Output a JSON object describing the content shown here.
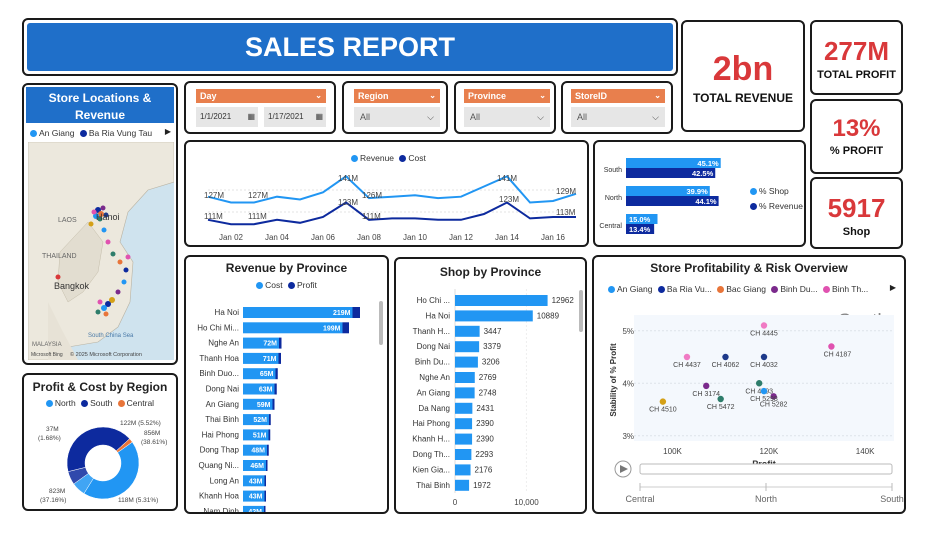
{
  "header": {
    "title": "SALES REPORT"
  },
  "kpis": {
    "revenue": {
      "value": "2bn",
      "label": "TOTAL REVENUE"
    },
    "profit": {
      "value": "277M",
      "label": "TOTAL PROFIT"
    },
    "profit_pct": {
      "value": "13%",
      "label": "% PROFIT"
    },
    "shop": {
      "value": "5917",
      "label": "Shop"
    }
  },
  "colors": {
    "revenue": "#2196f3",
    "cost": "#0d2a9e",
    "north": "#2196f3",
    "south": "#0d2a9e",
    "central": "#e8753a",
    "kpi_red": "#d9383a",
    "title_blue": "#1f6fc9"
  },
  "map": {
    "title": "Store Locations & Revenue",
    "legend": [
      {
        "label": "An Giang",
        "color": "#2196f3"
      },
      {
        "label": "Ba Ria Vung Tau",
        "color": "#0d2a9e"
      }
    ],
    "labels": {
      "hanoi": "Hanoi",
      "laos": "LAOS",
      "thailand": "THAILAND",
      "bangkok": "Bangkok",
      "scs": "South China Sea",
      "malaysia": "MALAYSIA",
      "credit": "© 2025 Microsoft Corporation",
      "bing": "Microsoft Bing"
    }
  },
  "filters": {
    "day": {
      "label": "Day",
      "start": "1/1/2021",
      "end": "1/17/2021"
    },
    "region": {
      "label": "Region",
      "value": "All"
    },
    "province": {
      "label": "Province",
      "value": "All"
    },
    "storeid": {
      "label": "StoreID",
      "value": "All"
    }
  },
  "line_chart": {
    "legend": {
      "revenue": "Revenue",
      "cost": "Cost"
    },
    "x_labels": [
      "Jan 02",
      "Jan 04",
      "Jan 06",
      "Jan 08",
      "Jan 10",
      "Jan 12",
      "Jan 14",
      "Jan 16"
    ],
    "revenue_labels": [
      "127M",
      "127M",
      "141M",
      "126M",
      "141M",
      "123M",
      "129M"
    ],
    "cost_labels": [
      "111M",
      "111M",
      "123M",
      "111M",
      "113M"
    ]
  },
  "region_bars": {
    "legend": {
      "shop": "% Shop",
      "revenue": "% Revenue"
    },
    "rows": [
      {
        "label": "South",
        "shop": "45.1%",
        "revenue": "42.5%"
      },
      {
        "label": "North",
        "shop": "39.9%",
        "revenue": "44.1%"
      },
      {
        "label": "Central",
        "shop": "15.0%",
        "revenue": "13.4%"
      }
    ]
  },
  "donut": {
    "title": "Profit & Cost by Region",
    "legend": [
      {
        "label": "North",
        "color": "#2196f3"
      },
      {
        "label": "South",
        "color": "#0d2a9e"
      },
      {
        "label": "Central",
        "color": "#e8753a"
      }
    ],
    "labels": {
      "tl1": "37M",
      "tl2": "(1.68%)",
      "tr1": "122M (5.52%)",
      "tr2": "856M",
      "tr3": "(38.61%)",
      "bl1": "823M",
      "bl2": "(37.16%)",
      "br1": "118M (5.31%)"
    }
  },
  "chart_data": [
    {
      "type": "line",
      "title": "",
      "x": [
        "Jan 01",
        "Jan 02",
        "Jan 03",
        "Jan 04",
        "Jan 05",
        "Jan 06",
        "Jan 07",
        "Jan 08",
        "Jan 09",
        "Jan 10",
        "Jan 11",
        "Jan 12",
        "Jan 13",
        "Jan 14",
        "Jan 15",
        "Jan 16",
        "Jan 17"
      ],
      "series": [
        {
          "name": "Revenue",
          "values": [
            127,
            123,
            123,
            127,
            125,
            130,
            141,
            126,
            127,
            128,
            126,
            127,
            134,
            141,
            123,
            124,
            129
          ]
        },
        {
          "name": "Cost",
          "values": [
            111,
            108,
            108,
            111,
            109,
            113,
            123,
            111,
            112,
            112,
            111,
            111,
            115,
            123,
            112,
            113,
            113
          ]
        }
      ]
    },
    {
      "type": "bar",
      "title": "Revenue by Province",
      "categories": [
        "Ha Noi",
        "Ho Chi Mi...",
        "Nghe An",
        "Thanh Hoa",
        "Binh Duo...",
        "Dong Nai",
        "An Giang",
        "Thai Binh",
        "Hai Phong",
        "Dong Thap",
        "Quang Ni...",
        "Long An",
        "Khanh Hoa",
        "Nam Dinh"
      ],
      "series": [
        {
          "name": "Cost",
          "values": [
            219,
            199,
            72,
            71,
            65,
            63,
            59,
            52,
            51,
            48,
            46,
            43,
            43,
            42
          ]
        },
        {
          "name": "Profit",
          "values": [
            30,
            26,
            10,
            10,
            9,
            9,
            8,
            7,
            7,
            7,
            6,
            6,
            6,
            6
          ]
        }
      ]
    },
    {
      "type": "bar",
      "title": "Shop by Province",
      "categories": [
        "Ho Chi ...",
        "Ha Noi",
        "Thanh H...",
        "Dong Nai",
        "Binh Du...",
        "Nghe An",
        "An Giang",
        "Da Nang",
        "Hai Phong",
        "Khanh H...",
        "Dong Th...",
        "Kien Gia...",
        "Thai Binh"
      ],
      "values": [
        12962,
        10889,
        3447,
        3379,
        3206,
        2769,
        2748,
        2431,
        2390,
        2390,
        2293,
        2176,
        1972
      ],
      "xlim": [
        0,
        14000
      ],
      "x_ticks": [
        "0",
        "10,000"
      ]
    },
    {
      "type": "bar",
      "title": "",
      "categories": [
        "South",
        "North",
        "Central"
      ],
      "series": [
        {
          "name": "% Shop",
          "values": [
            45.1,
            39.9,
            15.0
          ]
        },
        {
          "name": "% Revenue",
          "values": [
            42.5,
            44.1,
            13.4
          ]
        }
      ]
    },
    {
      "type": "pie",
      "title": "Profit & Cost by Region",
      "series": [
        {
          "name": "North",
          "values": [
            856,
            122
          ]
        },
        {
          "name": "South",
          "values": [
            823,
            118
          ]
        },
        {
          "name": "Central",
          "values": [
            37
          ]
        }
      ]
    },
    {
      "type": "scatter",
      "title": "Store Profitability & Risk Overview",
      "xlabel": "Profit",
      "ylabel": "Stability of % Profit",
      "x_ticks": [
        "100K",
        "120K",
        "140K"
      ],
      "y_ticks": [
        "5%",
        "4%",
        "3%"
      ],
      "play_axis": [
        "Central",
        "North",
        "South"
      ],
      "current_frame": "South",
      "legend": [
        {
          "label": "An Giang",
          "color": "#2196f3"
        },
        {
          "label": "Ba Ria Vu...",
          "color": "#0d2a9e"
        },
        {
          "label": "Bac Giang",
          "color": "#e8753a"
        },
        {
          "label": "Binh Du...",
          "color": "#7b2a8c"
        },
        {
          "label": "Binh Th...",
          "color": "#e052b0"
        }
      ],
      "points": [
        {
          "label": "CH 4445",
          "x": 119,
          "y": 5.1,
          "color": "#f07bc4"
        },
        {
          "label": "CH 4437",
          "x": 103,
          "y": 4.5,
          "color": "#f07bc4"
        },
        {
          "label": "CH 4062",
          "x": 111,
          "y": 4.5,
          "color": "#1e3a8a"
        },
        {
          "label": "CH 4032",
          "x": 119,
          "y": 4.5,
          "color": "#1e3a8a"
        },
        {
          "label": "CH 4187",
          "x": 133,
          "y": 4.7,
          "color": "#e052b0"
        },
        {
          "label": "CH 4793",
          "x": 118,
          "y": 4.0,
          "color": "#2e7d6b"
        },
        {
          "label": "CH 3174",
          "x": 107,
          "y": 3.95,
          "color": "#7b2a8c"
        },
        {
          "label": "CH 5472",
          "x": 110,
          "y": 3.7,
          "color": "#2e7d6b"
        },
        {
          "label": "CH 5282",
          "x": 121,
          "y": 3.75,
          "color": "#7b2a8c"
        },
        {
          "label": "CH 5298",
          "x": 119,
          "y": 3.85,
          "color": "#2196f3"
        },
        {
          "label": "CH 4510",
          "x": 98,
          "y": 3.65,
          "color": "#d4a017"
        }
      ]
    }
  ]
}
